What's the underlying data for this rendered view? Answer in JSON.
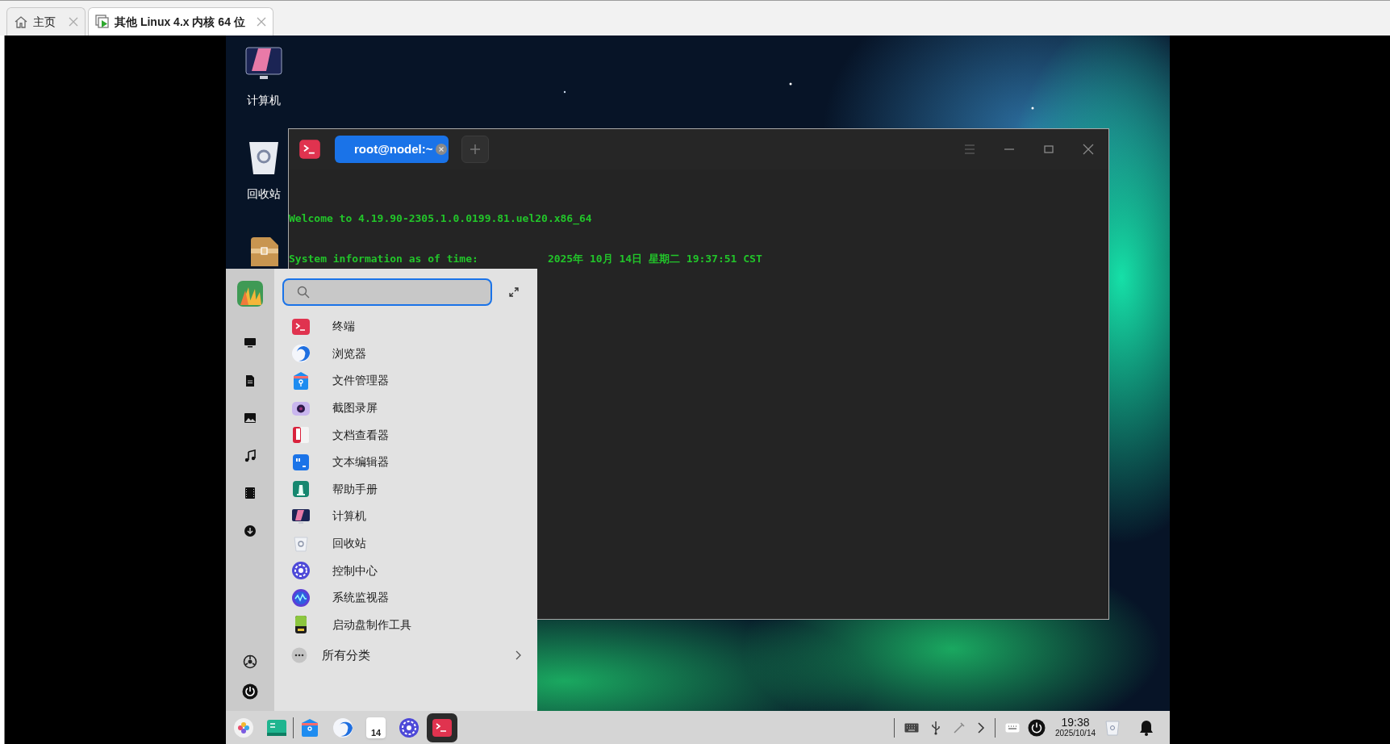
{
  "host_tabs": [
    {
      "label": "主页",
      "selected": false
    },
    {
      "label": "其他 Linux 4.x 内核 64 位",
      "selected": true
    }
  ],
  "desktop": {
    "icons": [
      {
        "kind": "computer",
        "label": "计算机"
      },
      {
        "kind": "trash",
        "label": "回收站"
      },
      {
        "kind": "archive"
      }
    ]
  },
  "terminal": {
    "tabs": [
      {
        "label": "root@nodel:~",
        "selected": true
      }
    ],
    "lines": [
      "Welcome to 4.19.90-2305.1.0.0199.81.uel20.x86_64",
      "System information as of time:           2025年 10月 14日 星期二 19:37:51 CST"
    ]
  },
  "launcher": {
    "items": [
      {
        "label": "终端"
      },
      {
        "label": "浏览器"
      },
      {
        "label": "文件管理器"
      },
      {
        "label": "截图录屏"
      },
      {
        "label": "文档查看器"
      },
      {
        "label": "文本编辑器"
      },
      {
        "label": "帮助手册"
      },
      {
        "label": "计算机"
      },
      {
        "label": "回收站"
      },
      {
        "label": "控制中心"
      },
      {
        "label": "系统监视器"
      },
      {
        "label": "启动盘制作工具"
      }
    ],
    "all_categories": "所有分类"
  },
  "taskbar": {
    "apps": [
      {
        "active": false
      },
      {
        "active": false
      },
      {
        "active": false
      },
      {
        "active": false
      },
      {
        "active": false
      },
      {
        "active": false
      },
      {
        "active": true
      }
    ],
    "calendar_day": "14",
    "time": "19:38",
    "date": "2025/10/14"
  }
}
